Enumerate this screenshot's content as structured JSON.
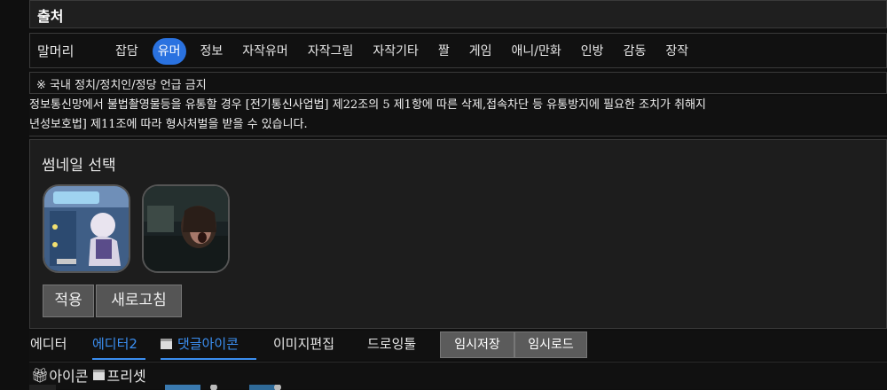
{
  "source": {
    "label": "출처"
  },
  "prefix": {
    "label": "말머리",
    "tags": [
      "잡담",
      "유머",
      "정보",
      "자작유머",
      "자작그림",
      "자작기타",
      "짤",
      "게임",
      "애니/만화",
      "인방",
      "감동",
      "장작"
    ],
    "active_tag": "유머"
  },
  "notice": {
    "text": "※ 국내 정치/정치인/정당 언급 금지"
  },
  "legal": {
    "line1": "정보통신망에서 불법촬영물등을 유통할 경우 [전기통신사업법] 제22조의 5 제1항에 따른 삭제,접속차단 등 유통방지에 필요한 조치가 취해지",
    "line2": "년성보호법] 제11조에 따라 형사처벌을 받을 수 있습니다."
  },
  "thumbnail": {
    "title": "썸네일 선택",
    "apply_label": "적용",
    "refresh_label": "새로고침"
  },
  "editor_tabs": {
    "editor": "에디터",
    "editor2": "에디터2",
    "reply_icon": "댓글아이콘",
    "image_edit": "이미지편집",
    "drawing": "드로잉툴",
    "temp_save": "임시저장",
    "temp_load": "임시로드"
  },
  "bottom": {
    "icons_label": "아이콘",
    "preset_label": "프리셋"
  },
  "colors": {
    "accent": "#2a72e0",
    "link": "#3b8ef0",
    "background": "#0f0f0f"
  }
}
